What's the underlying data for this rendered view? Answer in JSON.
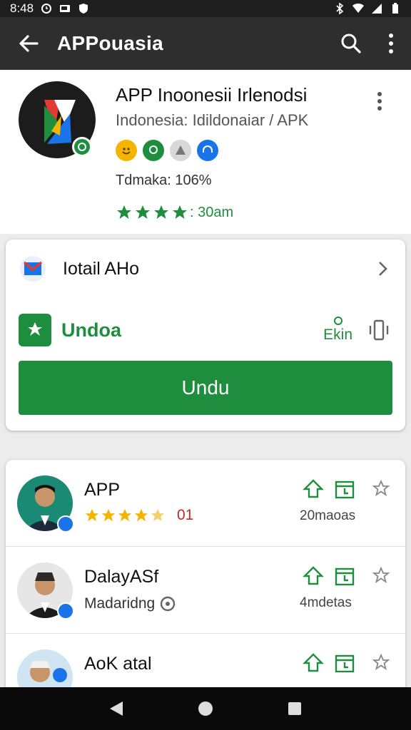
{
  "status_bar": {
    "time": "8:48"
  },
  "app_bar": {
    "title": "APPouasia"
  },
  "header": {
    "app_name": "APP Inoonesii Irlenodsi",
    "app_sub": "Indonesia: Idildonaiar / APK",
    "tdmaka": "Tdmaka: 106%",
    "rating_text": ": 30am",
    "rating_stars": 4,
    "colors": {
      "green": "#1e8e3e",
      "orange": "#f4b400",
      "blue": "#1a73e8"
    }
  },
  "card_main": {
    "detail_label": "Iotail AHo",
    "undoa_label": "Undoa",
    "ekin_label": "Ekin",
    "button_label": "Undu"
  },
  "list": {
    "items": [
      {
        "title": "APP",
        "stars": 4.5,
        "badge_num": "01",
        "count": "20maoas"
      },
      {
        "title": "DalayASf",
        "sub": "Madaridng",
        "count": "4mdetas"
      },
      {
        "title": "AoK atal"
      }
    ]
  }
}
